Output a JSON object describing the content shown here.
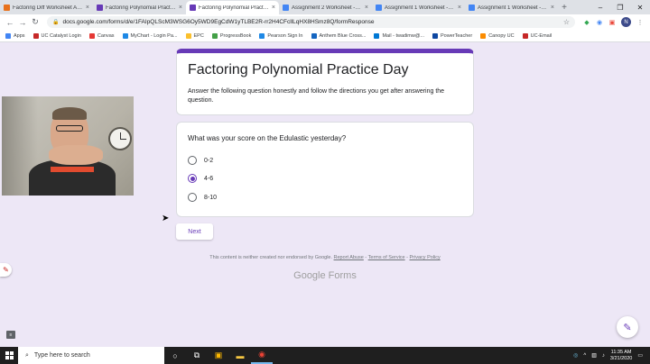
{
  "browser": {
    "tabs": [
      {
        "title": "Factoring Diff Worksheet Ans...",
        "favicon_color": "#e8711a",
        "active": false
      },
      {
        "title": "Factoring Polynomial Practice...",
        "favicon_color": "#673ab7",
        "active": false
      },
      {
        "title": "Factoring Polynomial Practic...",
        "favicon_color": "#673ab7",
        "active": true
      },
      {
        "title": "Assignment 2 Worksheet - G...",
        "favicon_color": "#4285f4",
        "active": false
      },
      {
        "title": "Assignment 1 Worksheet - G...",
        "favicon_color": "#4285f4",
        "active": false
      },
      {
        "title": "Assignment 1 Worksheet - G...",
        "favicon_color": "#4285f4",
        "active": false
      }
    ],
    "new_tab": "+",
    "url": "docs.google.com/forms/d/e/1FAIpQLScM3WSG6Oy5WD9EgCdW1yTLBE2R-rr2H4CFcllLqHX8HSmz8Q/formResponse",
    "avatar_letter": "N",
    "bookmarks": [
      {
        "label": "Apps",
        "color": "#4285f4"
      },
      {
        "label": "UC Catalyst Login",
        "color": "#c62828"
      },
      {
        "label": "Canvas",
        "color": "#e53935"
      },
      {
        "label": "MyChart - Login Pa...",
        "color": "#1e88e5"
      },
      {
        "label": "EPC",
        "color": "#fbc02d"
      },
      {
        "label": "ProgressBook",
        "color": "#43a047"
      },
      {
        "label": "Pearson Sign In",
        "color": "#1e88e5"
      },
      {
        "label": "Anthem Blue Cross...",
        "color": "#1565c0"
      },
      {
        "label": "Mail - twadimw@...",
        "color": "#0078d4"
      },
      {
        "label": "PowerTeacher",
        "color": "#0d47a1"
      },
      {
        "label": "Canopy UC",
        "color": "#fb8c00"
      },
      {
        "label": "UC-Email",
        "color": "#c62828"
      }
    ]
  },
  "form": {
    "title": "Factoring Polynomial Practice Day",
    "description": "Answer the following question honestly and follow the directions you get after answering the question.",
    "question": "What was your score on the Edulastic yesterday?",
    "options": [
      {
        "label": "0-2",
        "selected": false
      },
      {
        "label": "4-6",
        "selected": true
      },
      {
        "label": "8-10",
        "selected": false
      }
    ],
    "next_label": "Next",
    "footer_text": "This content is neither created nor endorsed by Google.",
    "footer_links": [
      "Report Abuse",
      "Terms of Service",
      "Privacy Policy"
    ],
    "branding": "Google Forms",
    "accent_color": "#673ab7"
  },
  "taskbar": {
    "search_placeholder": "Type here to search",
    "time": "11:35 AM",
    "date": "3/21/2020"
  }
}
